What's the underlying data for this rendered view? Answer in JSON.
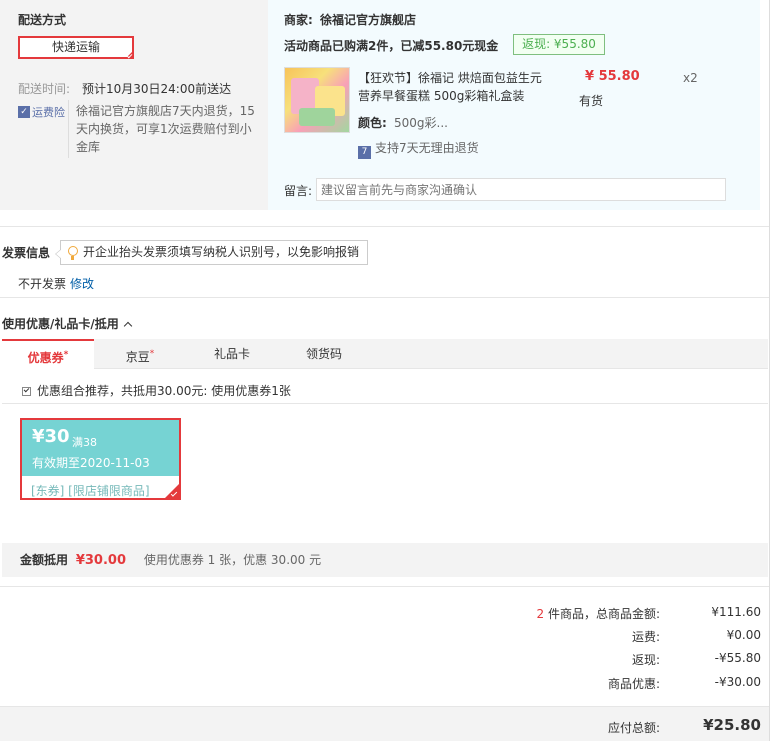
{
  "shipping": {
    "title": "配送方式",
    "method_label": "快递运输",
    "time_label": "配送时间:",
    "time_value": "预计10月30日24:00前送达",
    "freight_badge": "运费险",
    "freight_desc": "徐福记官方旗舰店7天内退货，15天内换货，可享1次运费赔付到小金库"
  },
  "store": {
    "merchant_label": "商家:",
    "merchant_name": "徐福记官方旗舰店",
    "promo_text": "活动商品已购满2件，已减55.80元现金",
    "rebate_tag": "返现: ¥55.80",
    "product": {
      "title": "【狂欢节】徐福记 烘焙面包益生元营养早餐蛋糕 500g彩箱礼盒装",
      "price": "¥ 55.80",
      "quantity": "x2",
      "stock": "有货",
      "color_label": "颜色:",
      "color_value": "500g彩...",
      "return_policy": "支持7天无理由退货",
      "return_icon": "z-icon"
    },
    "message_label": "留言:",
    "message_placeholder": "建议留言前先与商家沟通确认"
  },
  "invoice": {
    "title": "发票信息",
    "tip": "开企业抬头发票须填写纳税人识别号，以免影响报销",
    "status": "不开发票",
    "modify_link": "修改"
  },
  "discount": {
    "title": "使用优惠/礼品卡/抵用",
    "tabs": [
      {
        "label": "优惠券",
        "mark": "*"
      },
      {
        "label": "京豆",
        "mark": "*"
      },
      {
        "label": "礼品卡",
        "mark": ""
      },
      {
        "label": "领货码",
        "mark": ""
      }
    ],
    "recommend_text": "优惠组合推荐，共抵用30.00元: 使用优惠券1张",
    "coupon": {
      "amount": "¥30",
      "limit": "满38",
      "valid": "有效期至2020-11-03",
      "scope": "[东券] [限店铺限商品]"
    },
    "deduct_label": "金额抵用",
    "deduct_value": "¥30.00",
    "deduct_desc": "使用优惠券 1 张，优惠 30.00 元"
  },
  "summary": {
    "count": "2",
    "count_suffix": "件商品，总商品金额:",
    "goods_total": "¥111.60",
    "freight_label": "运费:",
    "freight_value": "¥0.00",
    "rebate_label": "返现:",
    "rebate_value": "-¥55.80",
    "discount_label": "商品优惠:",
    "discount_value": "-¥30.00",
    "payable_label": "应付总额:",
    "payable_value": "¥25.80"
  },
  "colors": {
    "accent": "#e4393c",
    "coupon_bg": "#76d3d3",
    "panel_gray": "#f3f3f3",
    "panel_blue": "#f3fbfe"
  }
}
